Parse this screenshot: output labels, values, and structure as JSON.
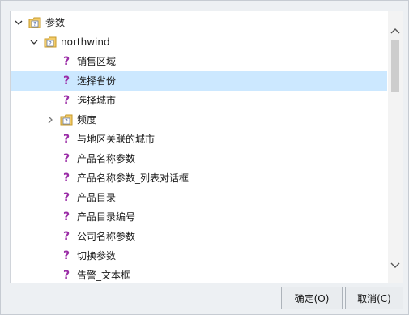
{
  "tree": {
    "root": {
      "label": "参数",
      "expanded": true,
      "icon": "parameter-folder-icon"
    },
    "group": {
      "label": "northwind",
      "expanded": true,
      "icon": "parameter-folder-icon"
    },
    "items": [
      {
        "label": "销售区域",
        "type": "parameter",
        "selected": false
      },
      {
        "label": "选择省份",
        "type": "parameter",
        "selected": true
      },
      {
        "label": "选择城市",
        "type": "parameter",
        "selected": false
      },
      {
        "label": "频度",
        "type": "folder",
        "expanded": false,
        "selected": false
      },
      {
        "label": "与地区关联的城市",
        "type": "parameter",
        "selected": false
      },
      {
        "label": "产品名称参数",
        "type": "parameter",
        "selected": false
      },
      {
        "label": "产品名称参数_列表对话框",
        "type": "parameter",
        "selected": false
      },
      {
        "label": "产品目录",
        "type": "parameter",
        "selected": false
      },
      {
        "label": "产品目录编号",
        "type": "parameter",
        "selected": false
      },
      {
        "label": "公司名称参数",
        "type": "parameter",
        "selected": false
      },
      {
        "label": "切换参数",
        "type": "parameter",
        "selected": false
      },
      {
        "label": "告警_文本框",
        "type": "parameter",
        "selected": false
      }
    ]
  },
  "buttons": {
    "ok": "确定(O)",
    "cancel": "取消(C)"
  },
  "colors": {
    "selection": "#cce8ff",
    "parameter_icon": "#9b2ea7",
    "folder_icon": "#e9b949"
  }
}
